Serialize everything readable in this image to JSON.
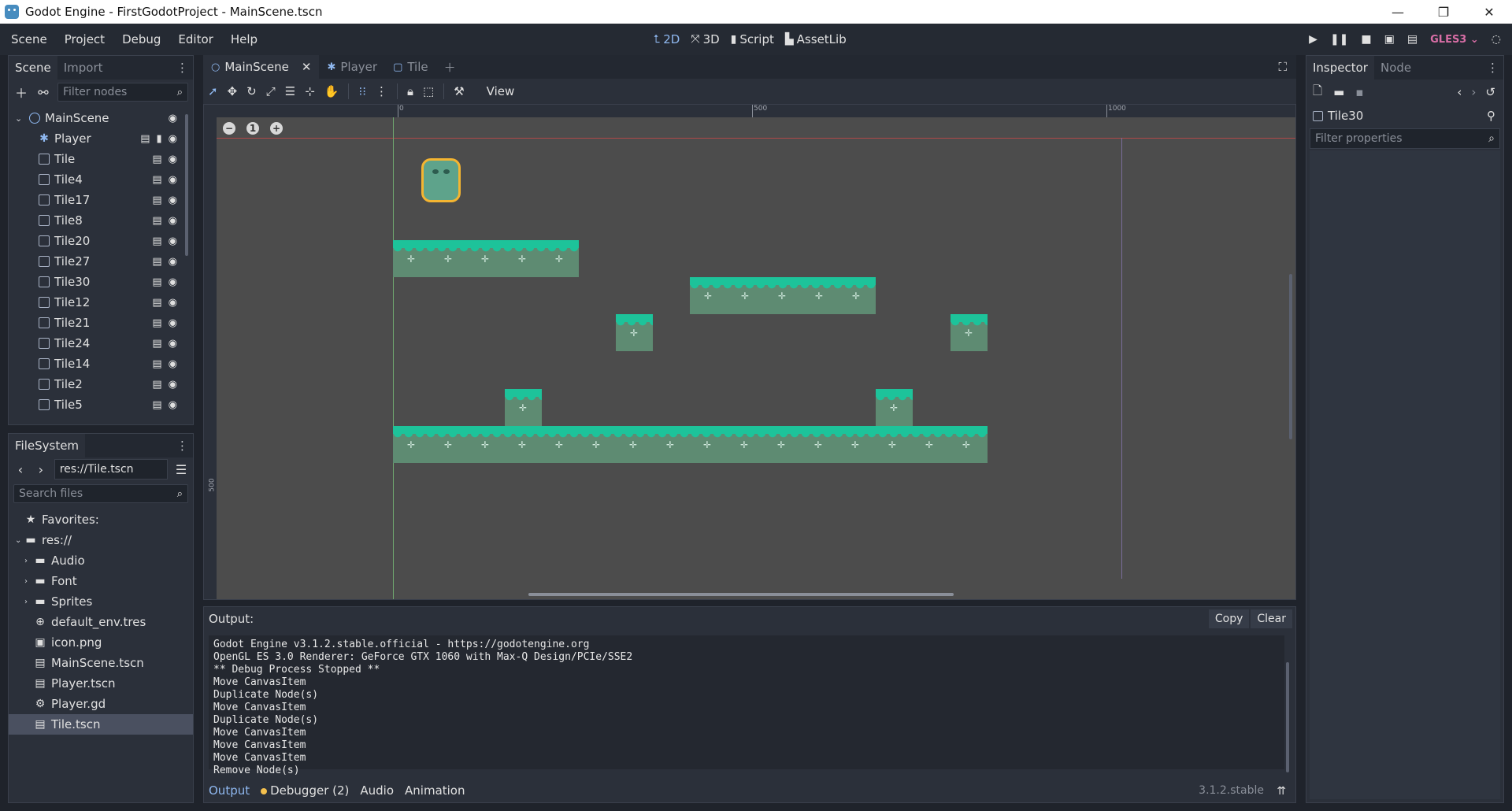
{
  "window": {
    "title": "Godot Engine - FirstGodotProject - MainScene.tscn",
    "controls": [
      "—",
      "❐",
      "✕"
    ]
  },
  "menubar": {
    "menus": [
      "Scene",
      "Project",
      "Debug",
      "Editor",
      "Help"
    ],
    "workspaces": [
      {
        "label": "2D",
        "icon": "2d-icon",
        "active": true
      },
      {
        "label": "3D",
        "icon": "3d-icon",
        "active": false
      },
      {
        "label": "Script",
        "icon": "script-icon",
        "active": false
      },
      {
        "label": "AssetLib",
        "icon": "assetlib-icon",
        "active": false
      }
    ],
    "renderer": "GLES3"
  },
  "scene_dock": {
    "tabs": [
      "Scene",
      "Import"
    ],
    "filter_placeholder": "Filter nodes",
    "nodes": [
      {
        "name": "MainScene",
        "type": "root"
      },
      {
        "name": "Player",
        "type": "kinematic"
      },
      {
        "name": "Tile",
        "type": "instance"
      },
      {
        "name": "Tile4",
        "type": "instance"
      },
      {
        "name": "Tile17",
        "type": "instance"
      },
      {
        "name": "Tile8",
        "type": "instance"
      },
      {
        "name": "Tile20",
        "type": "instance"
      },
      {
        "name": "Tile27",
        "type": "instance"
      },
      {
        "name": "Tile30",
        "type": "instance"
      },
      {
        "name": "Tile12",
        "type": "instance"
      },
      {
        "name": "Tile21",
        "type": "instance"
      },
      {
        "name": "Tile24",
        "type": "instance"
      },
      {
        "name": "Tile14",
        "type": "instance"
      },
      {
        "name": "Tile2",
        "type": "instance"
      },
      {
        "name": "Tile5",
        "type": "instance"
      }
    ]
  },
  "filesystem_dock": {
    "tab": "FileSystem",
    "path": "res://Tile.tscn",
    "search_placeholder": "Search files",
    "items": [
      {
        "label": "Favorites:",
        "icon": "star-icon",
        "glyph": "★",
        "level": 0,
        "arrow": ""
      },
      {
        "label": "res://",
        "icon": "folder-icon",
        "glyph": "▬",
        "level": 0,
        "arrow": "⌄"
      },
      {
        "label": "Audio",
        "icon": "folder-icon",
        "glyph": "▬",
        "level": 1,
        "arrow": "›"
      },
      {
        "label": "Font",
        "icon": "folder-icon",
        "glyph": "▬",
        "level": 1,
        "arrow": "›"
      },
      {
        "label": "Sprites",
        "icon": "folder-icon",
        "glyph": "▬",
        "level": 1,
        "arrow": "›"
      },
      {
        "label": "default_env.tres",
        "icon": "globe-icon",
        "glyph": "⊕",
        "level": 1,
        "arrow": ""
      },
      {
        "label": "icon.png",
        "icon": "image-icon",
        "glyph": "▣",
        "level": 1,
        "arrow": ""
      },
      {
        "label": "MainScene.tscn",
        "icon": "scene-icon",
        "glyph": "▤",
        "level": 1,
        "arrow": ""
      },
      {
        "label": "Player.tscn",
        "icon": "scene-icon",
        "glyph": "▤",
        "level": 1,
        "arrow": ""
      },
      {
        "label": "Player.gd",
        "icon": "gear-icon",
        "glyph": "⚙",
        "level": 1,
        "arrow": ""
      },
      {
        "label": "Tile.tscn",
        "icon": "scene-icon",
        "glyph": "▤",
        "level": 1,
        "arrow": "",
        "selected": true
      }
    ]
  },
  "editor": {
    "tabs": [
      {
        "label": "MainScene",
        "active": true
      },
      {
        "label": "Player",
        "active": false
      },
      {
        "label": "Tile",
        "active": false
      }
    ],
    "view_menu": "View",
    "ruler_labels": [
      "0",
      "500",
      "1000"
    ],
    "ruler_left_label": "500",
    "zoom_reset": "1"
  },
  "output": {
    "title": "Output:",
    "copy_label": "Copy",
    "clear_label": "Clear",
    "lines": [
      "Godot Engine v3.1.2.stable.official - https://godotengine.org",
      "OpenGL ES 3.0 Renderer: GeForce GTX 1060 with Max-Q Design/PCIe/SSE2",
      "** Debug Process Stopped **",
      "Move CanvasItem",
      "Duplicate Node(s)",
      "Move CanvasItem",
      "Duplicate Node(s)",
      "Move CanvasItem",
      "Move CanvasItem",
      "Move CanvasItem",
      "Remove Node(s)"
    ],
    "bottom_tabs": [
      "Output",
      "Debugger (2)",
      "Audio",
      "Animation"
    ],
    "version": "3.1.2.stable"
  },
  "inspector": {
    "tabs": [
      "Inspector",
      "Node"
    ],
    "object_name": "Tile30",
    "filter_placeholder": "Filter properties"
  },
  "colors": {
    "accent": "#8fb8f0",
    "grass": "#1dc39a",
    "tile": "#5e8b72",
    "gles": "#d96ea6",
    "debugger_dot": "#f4c04e"
  }
}
